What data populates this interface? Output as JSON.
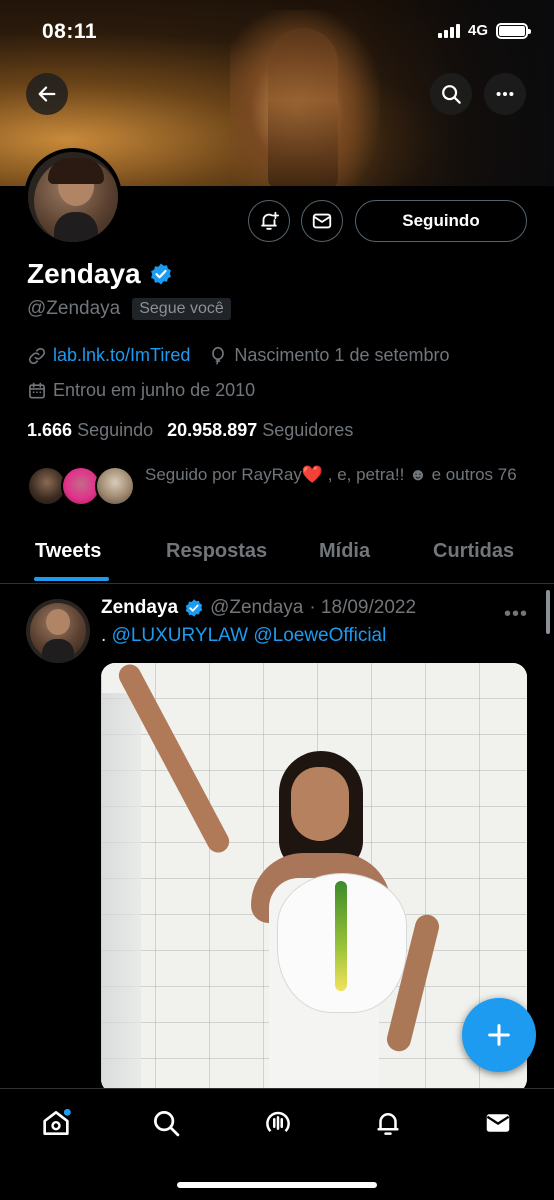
{
  "status_bar": {
    "time": "08:11",
    "network": "4G"
  },
  "profile": {
    "name": "Zendaya",
    "handle": "@Zendaya",
    "follows_you_badge": "Segue você",
    "follow_button_label": "Seguindo",
    "link": "lab.lnk.to/ImTired",
    "birthday": "Nascimento 1 de setembro",
    "joined": "Entrou em junho de 2010",
    "following_count": "1.666",
    "following_label": "Seguindo",
    "followers_count": "20.958.897",
    "followers_label": "Seguidores",
    "followed_by_text": "Seguido por RayRay❤️ , e, petra!! ☻ e outros 76"
  },
  "tabs": [
    {
      "label": "Tweets"
    },
    {
      "label": "Respostas"
    },
    {
      "label": "Mídia"
    },
    {
      "label": "Curtidas"
    }
  ],
  "tweet": {
    "author_name": "Zendaya",
    "author_handle": "@Zendaya",
    "date": "· 18/09/2022",
    "text_prefix": ".",
    "mention_1": "@LUXURYLAW",
    "mention_2": "@LoeweOfficial"
  },
  "icons": {
    "back": "arrow-left-icon",
    "search": "search-icon",
    "more": "more-horizontal-icon",
    "notify": "bell-plus-icon",
    "message": "envelope-icon",
    "verified": "verified-badge-icon",
    "link": "link-icon",
    "birthday": "balloon-icon",
    "calendar": "calendar-icon",
    "compose": "plus-icon",
    "nav": [
      "home-icon",
      "search-icon",
      "spaces-icon",
      "bell-icon",
      "mail-icon"
    ]
  },
  "colors": {
    "accent": "#1d9bf0",
    "background": "#000000",
    "secondary_text": "#71767b"
  }
}
